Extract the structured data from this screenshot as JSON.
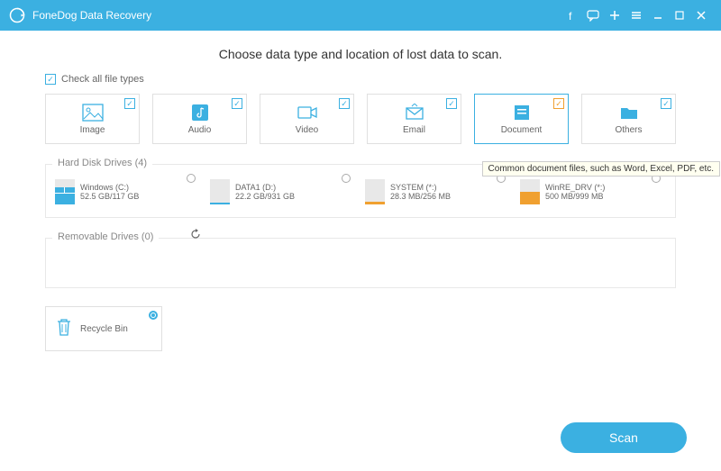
{
  "app": {
    "title": "FoneDog Data Recovery"
  },
  "heading": "Choose data type and location of lost data to scan.",
  "checkall_label": "Check all file types",
  "types": [
    {
      "name": "image",
      "label": "Image",
      "checked": true
    },
    {
      "name": "audio",
      "label": "Audio",
      "checked": true
    },
    {
      "name": "video",
      "label": "Video",
      "checked": true
    },
    {
      "name": "email",
      "label": "Email",
      "checked": true
    },
    {
      "name": "document",
      "label": "Document",
      "checked": true,
      "active": true
    },
    {
      "name": "others",
      "label": "Others",
      "checked": true
    }
  ],
  "document_tooltip": "Common document files, such as Word, Excel, PDF, etc.",
  "sections": {
    "hdd": {
      "title": "Hard Disk Drives (4)"
    },
    "removable": {
      "title": "Removable Drives (0)"
    }
  },
  "drives": [
    {
      "name": "Windows (C:)",
      "usage": "52.5 GB/117 GB",
      "fill_pct": 45,
      "color": "#3bb0e1"
    },
    {
      "name": "DATA1 (D:)",
      "usage": "22.2 GB/931 GB",
      "fill_pct": 6,
      "color": "#3bb0e1"
    },
    {
      "name": "SYSTEM (*:)",
      "usage": "28.3 MB/256 MB",
      "fill_pct": 12,
      "color": "#f0a030"
    },
    {
      "name": "WinRE_DRV (*:)",
      "usage": "500 MB/999 MB",
      "fill_pct": 50,
      "color": "#f0a030"
    }
  ],
  "recycle": {
    "label": "Recycle Bin",
    "selected": true
  },
  "scan_label": "Scan"
}
